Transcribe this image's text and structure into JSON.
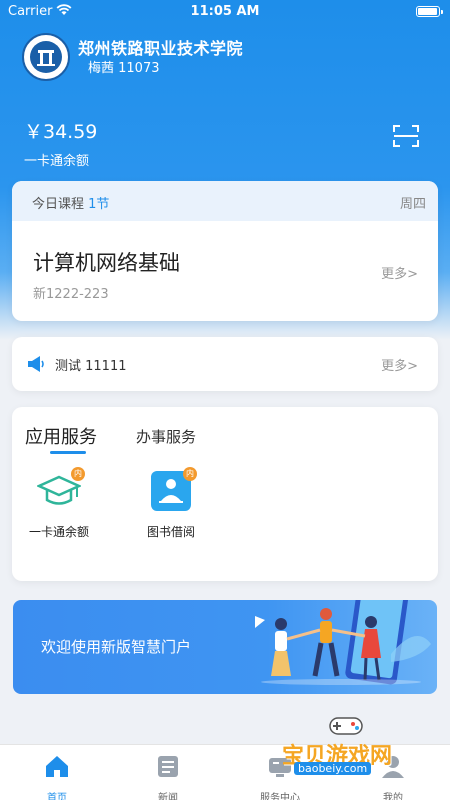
{
  "status_bar": {
    "carrier": "Carrier",
    "time": "11:05 AM"
  },
  "header": {
    "school_name": "郑州铁路职业技术学院",
    "user": "梅茜  11073",
    "logo_icon": "school-emblem"
  },
  "balance": {
    "amount": "￥34.59",
    "label": "一卡通余额",
    "scan_icon": "scan-icon"
  },
  "course": {
    "header_label": "今日课程",
    "count": "1节",
    "weekday": "周四",
    "title": "计算机网络基础",
    "code": "新1222-223",
    "more": "更多>"
  },
  "notice": {
    "text": "测试 11111",
    "more": "更多>",
    "icon": "megaphone-icon"
  },
  "services": {
    "tabs": [
      {
        "label": "应用服务",
        "active": true
      },
      {
        "label": "办事服务",
        "active": false
      }
    ],
    "items": [
      {
        "label": "一卡通余额",
        "badge": "内",
        "icon": "graduation-cap-icon"
      },
      {
        "label": "图书借阅",
        "badge": "内",
        "icon": "library-reader-icon"
      }
    ]
  },
  "banner": {
    "text": "欢迎使用新版智慧门户"
  },
  "tabbar": {
    "items": [
      {
        "label": "首页",
        "icon": "home-icon",
        "active": true
      },
      {
        "label": "新闻",
        "icon": "news-icon",
        "active": false
      },
      {
        "label": "服务中心",
        "icon": "service-center-icon",
        "active": false
      },
      {
        "label": "我的",
        "icon": "profile-icon",
        "active": false
      }
    ]
  },
  "watermark": {
    "text": "宝贝游戏网",
    "url": "baobeiy.com"
  },
  "colors": {
    "accent": "#1e8eea",
    "badge": "#f39a2e",
    "icon_green": "#2fb59a"
  }
}
